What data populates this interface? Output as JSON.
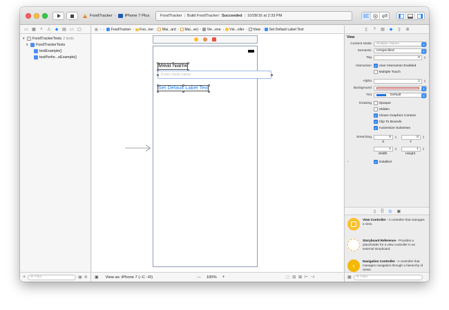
{
  "titlebar": {
    "scheme_app": "FoodTracker",
    "scheme_device": "iPhone 7 Plus",
    "status_app": "FoodTracker",
    "status_prefix": "Build FoodTracker:",
    "status_result": "Succeeded",
    "status_time": "10/28/16 at 2:33 PM"
  },
  "navigator": {
    "rows": [
      {
        "label": "FoodTrackerTests",
        "badge": "2 tests"
      },
      {
        "label": "FoodTrackerTests"
      },
      {
        "label": "testExample()"
      },
      {
        "label": "testPerfor...eExample()"
      }
    ],
    "filter_placeholder": "Filter"
  },
  "jumpbar": {
    "items": [
      "FoodTracker",
      "Foo...ker",
      "Mai...ard",
      "Mai...se)",
      "Vie...ene",
      "Vie...oller",
      "View",
      "Set Default Label Text"
    ]
  },
  "canvas": {
    "label_text": "Meal Name",
    "textfield_placeholder": "Enter meal name",
    "button_text": "Set Default Label Text"
  },
  "editor_footer": {
    "view_as": "View as: iPhone 7 (−C −R)",
    "minus": "—",
    "zoom": "100%",
    "plus": "+"
  },
  "inspector": {
    "section": "View",
    "content_mode_label": "Content Mode",
    "content_mode_value": "Multiple Values",
    "semantic_label": "Semantic",
    "semantic_value": "Unspecified",
    "tag_label": "Tag",
    "tag_value": "0",
    "interaction_label": "Interaction",
    "user_interaction": "User Interaction Enabled",
    "multiple_touch": "Multiple Touch",
    "alpha_label": "Alpha",
    "alpha_value": "1",
    "background_label": "Background",
    "tint_label": "Tint",
    "tint_value": "Default",
    "drawing_label": "Drawing",
    "opaque": "Opaque",
    "hidden": "Hidden",
    "clears": "Clears Graphics Context",
    "clip": "Clip To Bounds",
    "autoresize": "Autoresize Subviews",
    "stretching_label": "Stretching",
    "stretch_x": "0",
    "stretch_y": "0",
    "x_label": "X",
    "y_label": "Y",
    "stretch_w": "1",
    "stretch_h": "1",
    "width_label": "Width",
    "height_label": "Height",
    "installed": "Installed"
  },
  "library": {
    "items": [
      {
        "title": "View Controller",
        "desc": " - A controller that manages a view."
      },
      {
        "title": "Storyboard Reference",
        "desc": " - Provides a placeholder for a view controller in an external storyboard."
      },
      {
        "title": "Navigation Controller",
        "desc": " - A controller that manages navigation through a hierarchy of views."
      }
    ],
    "filter_placeholder": "Filter"
  },
  "colors": {
    "accent": "#1a82fb",
    "vc_yellow": "#fbc02d",
    "nav_yellow": "#f5b800"
  }
}
